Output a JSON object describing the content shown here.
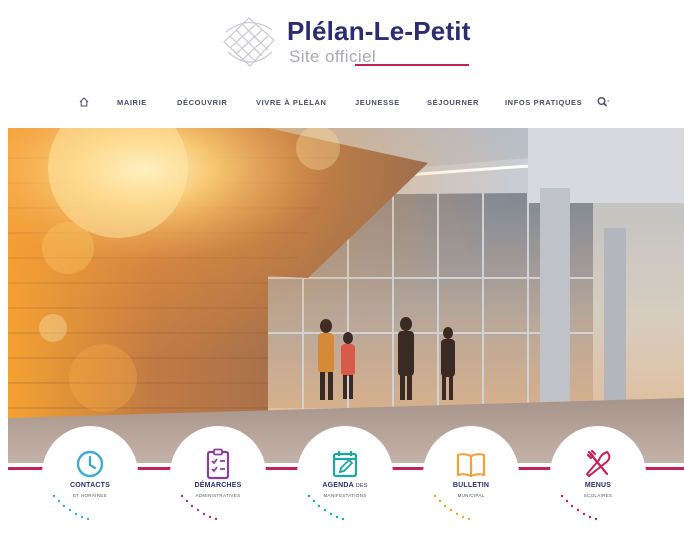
{
  "site": {
    "name": "Plélan-Le-Petit",
    "subtitle": "Site officiel"
  },
  "nav": {
    "home_icon": "home-icon",
    "items": [
      {
        "label": "MAIRIE"
      },
      {
        "label": "DÉCOUVRIR"
      },
      {
        "label": "VIVRE À PLÉLAN"
      },
      {
        "label": "JEUNESSE"
      },
      {
        "label": "SÉJOURNER"
      },
      {
        "label": "INFOS PRATIQUES"
      }
    ],
    "search_icon": "search-icon"
  },
  "hero": {
    "description_icon": "photo"
  },
  "quick_links": [
    {
      "title": "CONTACTS",
      "subtitle": "ET HORAIRES",
      "icon": "clock-icon",
      "color": "#3fa9d6"
    },
    {
      "title": "DÉMARCHES",
      "subtitle": "ADMINISTRATIVES",
      "icon": "checklist-icon",
      "color": "#8b3d9c"
    },
    {
      "title": "AGENDA",
      "title_suffix": "DES",
      "subtitle": "MANIFESTATIONS",
      "icon": "calendar-edit-icon",
      "color": "#1ba8a0"
    },
    {
      "title": "BULLETIN",
      "subtitle": "MUNICIPAL",
      "icon": "book-icon",
      "color": "#f0a23a"
    },
    {
      "title": "MENUS",
      "subtitle": "SCOLAIRES",
      "icon": "fork-knife-icon",
      "color": "#c4205a"
    }
  ],
  "colors": {
    "brand_dark": "#2d2d6e",
    "brand_accent": "#c4205a",
    "subtitle_grey": "#a9a9b8"
  }
}
